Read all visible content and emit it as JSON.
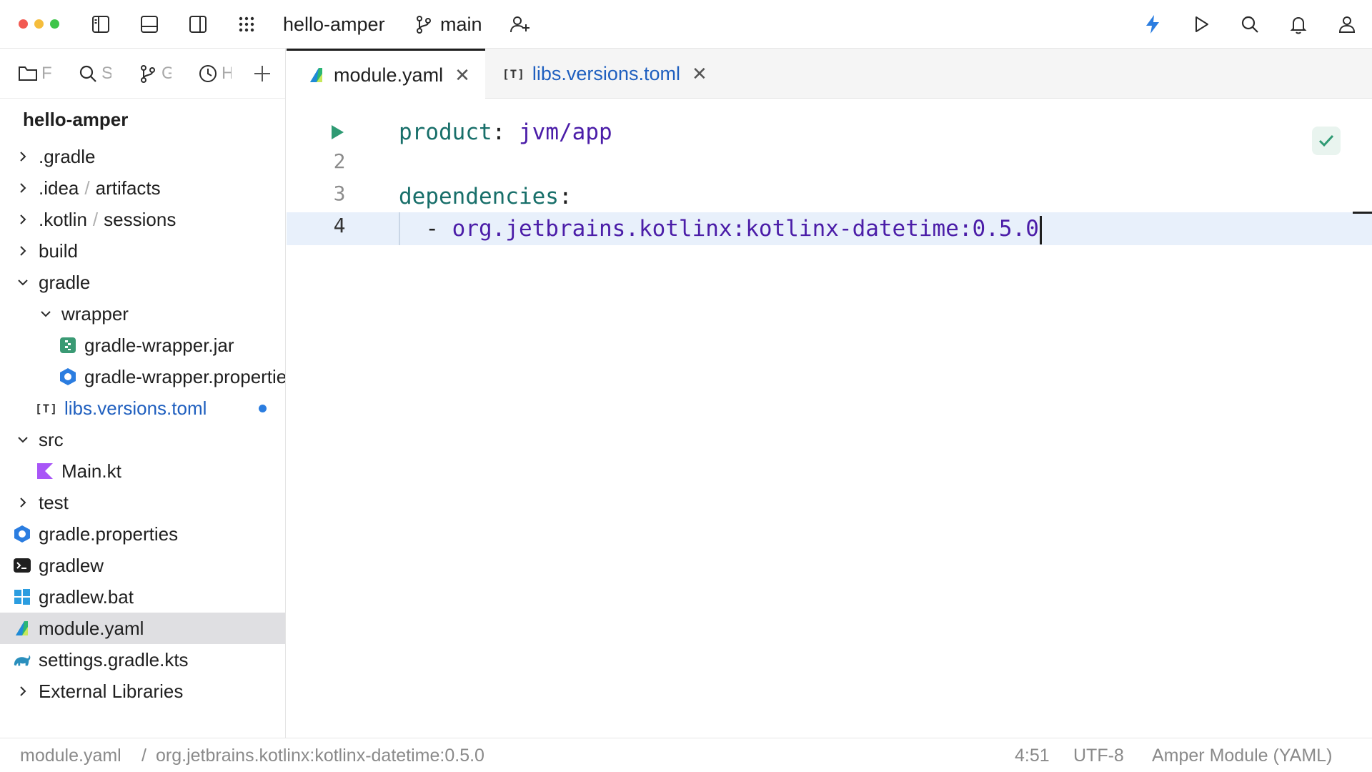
{
  "window": {
    "project_name": "hello-amper",
    "branch": "main"
  },
  "sidebar": {
    "tabs": [
      {
        "icon": "folder-icon",
        "label": "F"
      },
      {
        "icon": "search-icon",
        "label": "S"
      },
      {
        "icon": "branch-icon",
        "label": "G"
      },
      {
        "icon": "clock-icon",
        "label": "H"
      },
      {
        "icon": "plus-icon",
        "label": ""
      }
    ],
    "project_title": "hello-amper",
    "tree": [
      {
        "name": ".gradle",
        "level": 0,
        "expand": "collapsed"
      },
      {
        "name": ".idea",
        "suffix": "artifacts",
        "level": 0,
        "expand": "collapsed"
      },
      {
        "name": ".kotlin",
        "suffix": "sessions",
        "level": 0,
        "expand": "collapsed"
      },
      {
        "name": "build",
        "level": 0,
        "expand": "collapsed"
      },
      {
        "name": "gradle",
        "level": 0,
        "expand": "expanded"
      },
      {
        "name": "wrapper",
        "level": 1,
        "expand": "expanded"
      },
      {
        "name": "gradle-wrapper.jar",
        "level": 2,
        "icon": "jar-file-icon"
      },
      {
        "name": "gradle-wrapper.properties",
        "level": 2,
        "icon": "properties-file-icon"
      },
      {
        "name": "libs.versions.toml",
        "level": 1,
        "icon": "toml-file-icon",
        "modified": true
      },
      {
        "name": "src",
        "level": 0,
        "expand": "expanded"
      },
      {
        "name": "Main.kt",
        "level": 1,
        "icon": "kotlin-file-icon"
      },
      {
        "name": "test",
        "level": 0,
        "expand": "collapsed"
      },
      {
        "name": "gradle.properties",
        "level": 0,
        "icon": "properties-file-icon"
      },
      {
        "name": "gradlew",
        "level": 0,
        "icon": "terminal-file-icon"
      },
      {
        "name": "gradlew.bat",
        "level": 0,
        "icon": "windows-file-icon"
      },
      {
        "name": "module.yaml",
        "level": 0,
        "icon": "amper-file-icon",
        "selected": true
      },
      {
        "name": "settings.gradle.kts",
        "level": 0,
        "icon": "gradle-elephant-icon"
      },
      {
        "name": "External Libraries",
        "level": 0,
        "expand": "collapsed"
      }
    ]
  },
  "editor": {
    "tabs": [
      {
        "label": "module.yaml",
        "active": true,
        "icon": "amper-file-icon"
      },
      {
        "label": "libs.versions.toml",
        "active": false,
        "icon": "toml-file-icon",
        "badge": "[T]"
      }
    ],
    "lines": [
      {
        "number": "1",
        "key": "product",
        "colon": ":",
        "value": "jvm/app"
      },
      {
        "number": "2"
      },
      {
        "number": "3",
        "key": "dependencies",
        "colon": ":"
      },
      {
        "number": "4",
        "dash": "  - ",
        "value": "org.jetbrains.kotlinx:kotlinx-datetime:0.5.0",
        "current": true
      }
    ]
  },
  "statusbar": {
    "breadcrumb_file": "module.yaml",
    "breadcrumb_sep": "/",
    "breadcrumb_item": "org.jetbrains.kotlinx:kotlinx-datetime:0.5.0",
    "position": "4:51",
    "encoding": "UTF-8",
    "file_type": "Amper Module (YAML)"
  },
  "colors": {
    "accent_blue": "#2b7de0",
    "yaml_key": "#186f6a",
    "yaml_value": "#4b1da8",
    "current_line": "#e8f0fb"
  }
}
